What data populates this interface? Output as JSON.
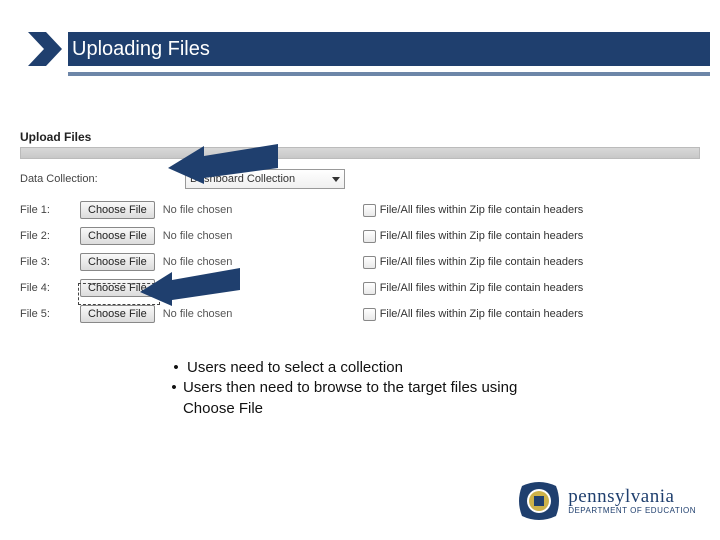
{
  "header": {
    "title": "Uploading Files"
  },
  "upload": {
    "section_title": "Upload Files",
    "data_collection_label": "Data Collection:",
    "collection_selected": "Dashboard Collection",
    "no_file_text": "No file chosen",
    "choose_label": "Choose File",
    "zip_header_label": "File/All files within Zip file contain headers",
    "files": [
      {
        "label": "File 1:"
      },
      {
        "label": "File 2:"
      },
      {
        "label": "File 3:"
      },
      {
        "label": "File 4:"
      },
      {
        "label": "File 5:"
      }
    ]
  },
  "bullets": {
    "b1": "Users need to select a collection",
    "b2": "Users then need to browse to the target files using Choose File"
  },
  "footer": {
    "state": "pennsylvania",
    "dept": "DEPARTMENT OF EDUCATION"
  },
  "colors": {
    "navy": "#1f3f6e"
  }
}
